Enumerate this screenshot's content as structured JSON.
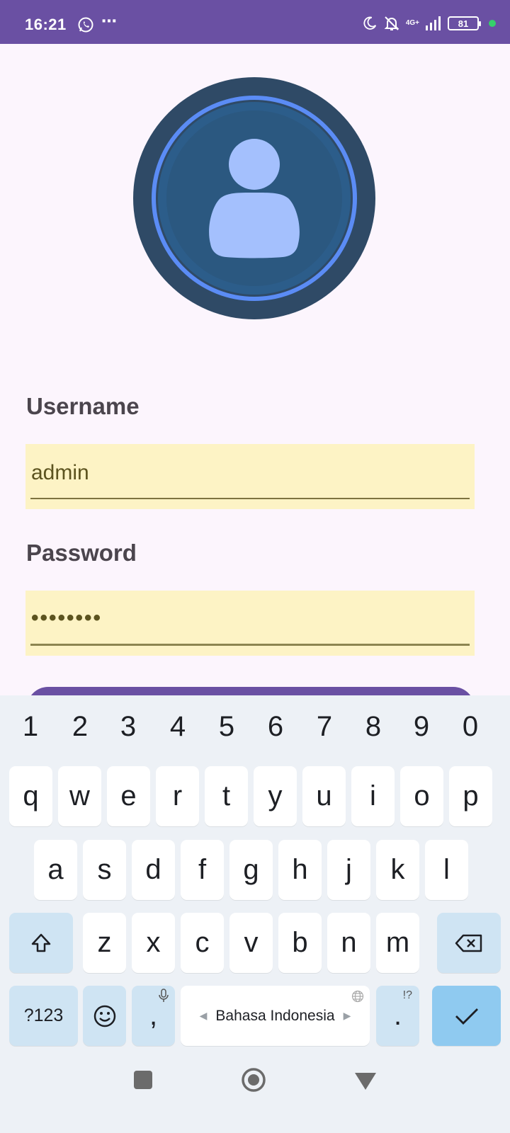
{
  "status_bar": {
    "time": "16:21",
    "more": "⋯",
    "network": "4G+",
    "battery": "81"
  },
  "form": {
    "username_label": "Username",
    "username_value": "admin",
    "password_label": "Password",
    "password_value": "••••••••"
  },
  "keyboard": {
    "numbers": [
      "1",
      "2",
      "3",
      "4",
      "5",
      "6",
      "7",
      "8",
      "9",
      "0"
    ],
    "row1": [
      "q",
      "w",
      "e",
      "r",
      "t",
      "y",
      "u",
      "i",
      "o",
      "p"
    ],
    "row2": [
      "a",
      "s",
      "d",
      "f",
      "g",
      "h",
      "j",
      "k",
      "l"
    ],
    "row3": [
      "z",
      "x",
      "c",
      "v",
      "b",
      "n",
      "m"
    ],
    "symbols_label": "?123",
    "comma": ",",
    "space_label": "Bahasa Indonesia",
    "period": ".",
    "period_hint": "!?"
  },
  "colors": {
    "accent": "#6a50a3",
    "field_bg": "#fdf3c5",
    "avatar_outer": "#2f4a66",
    "avatar_ring": "#5b8cf5",
    "avatar_inner": "#2b5880",
    "person": "#a4c0fd"
  }
}
